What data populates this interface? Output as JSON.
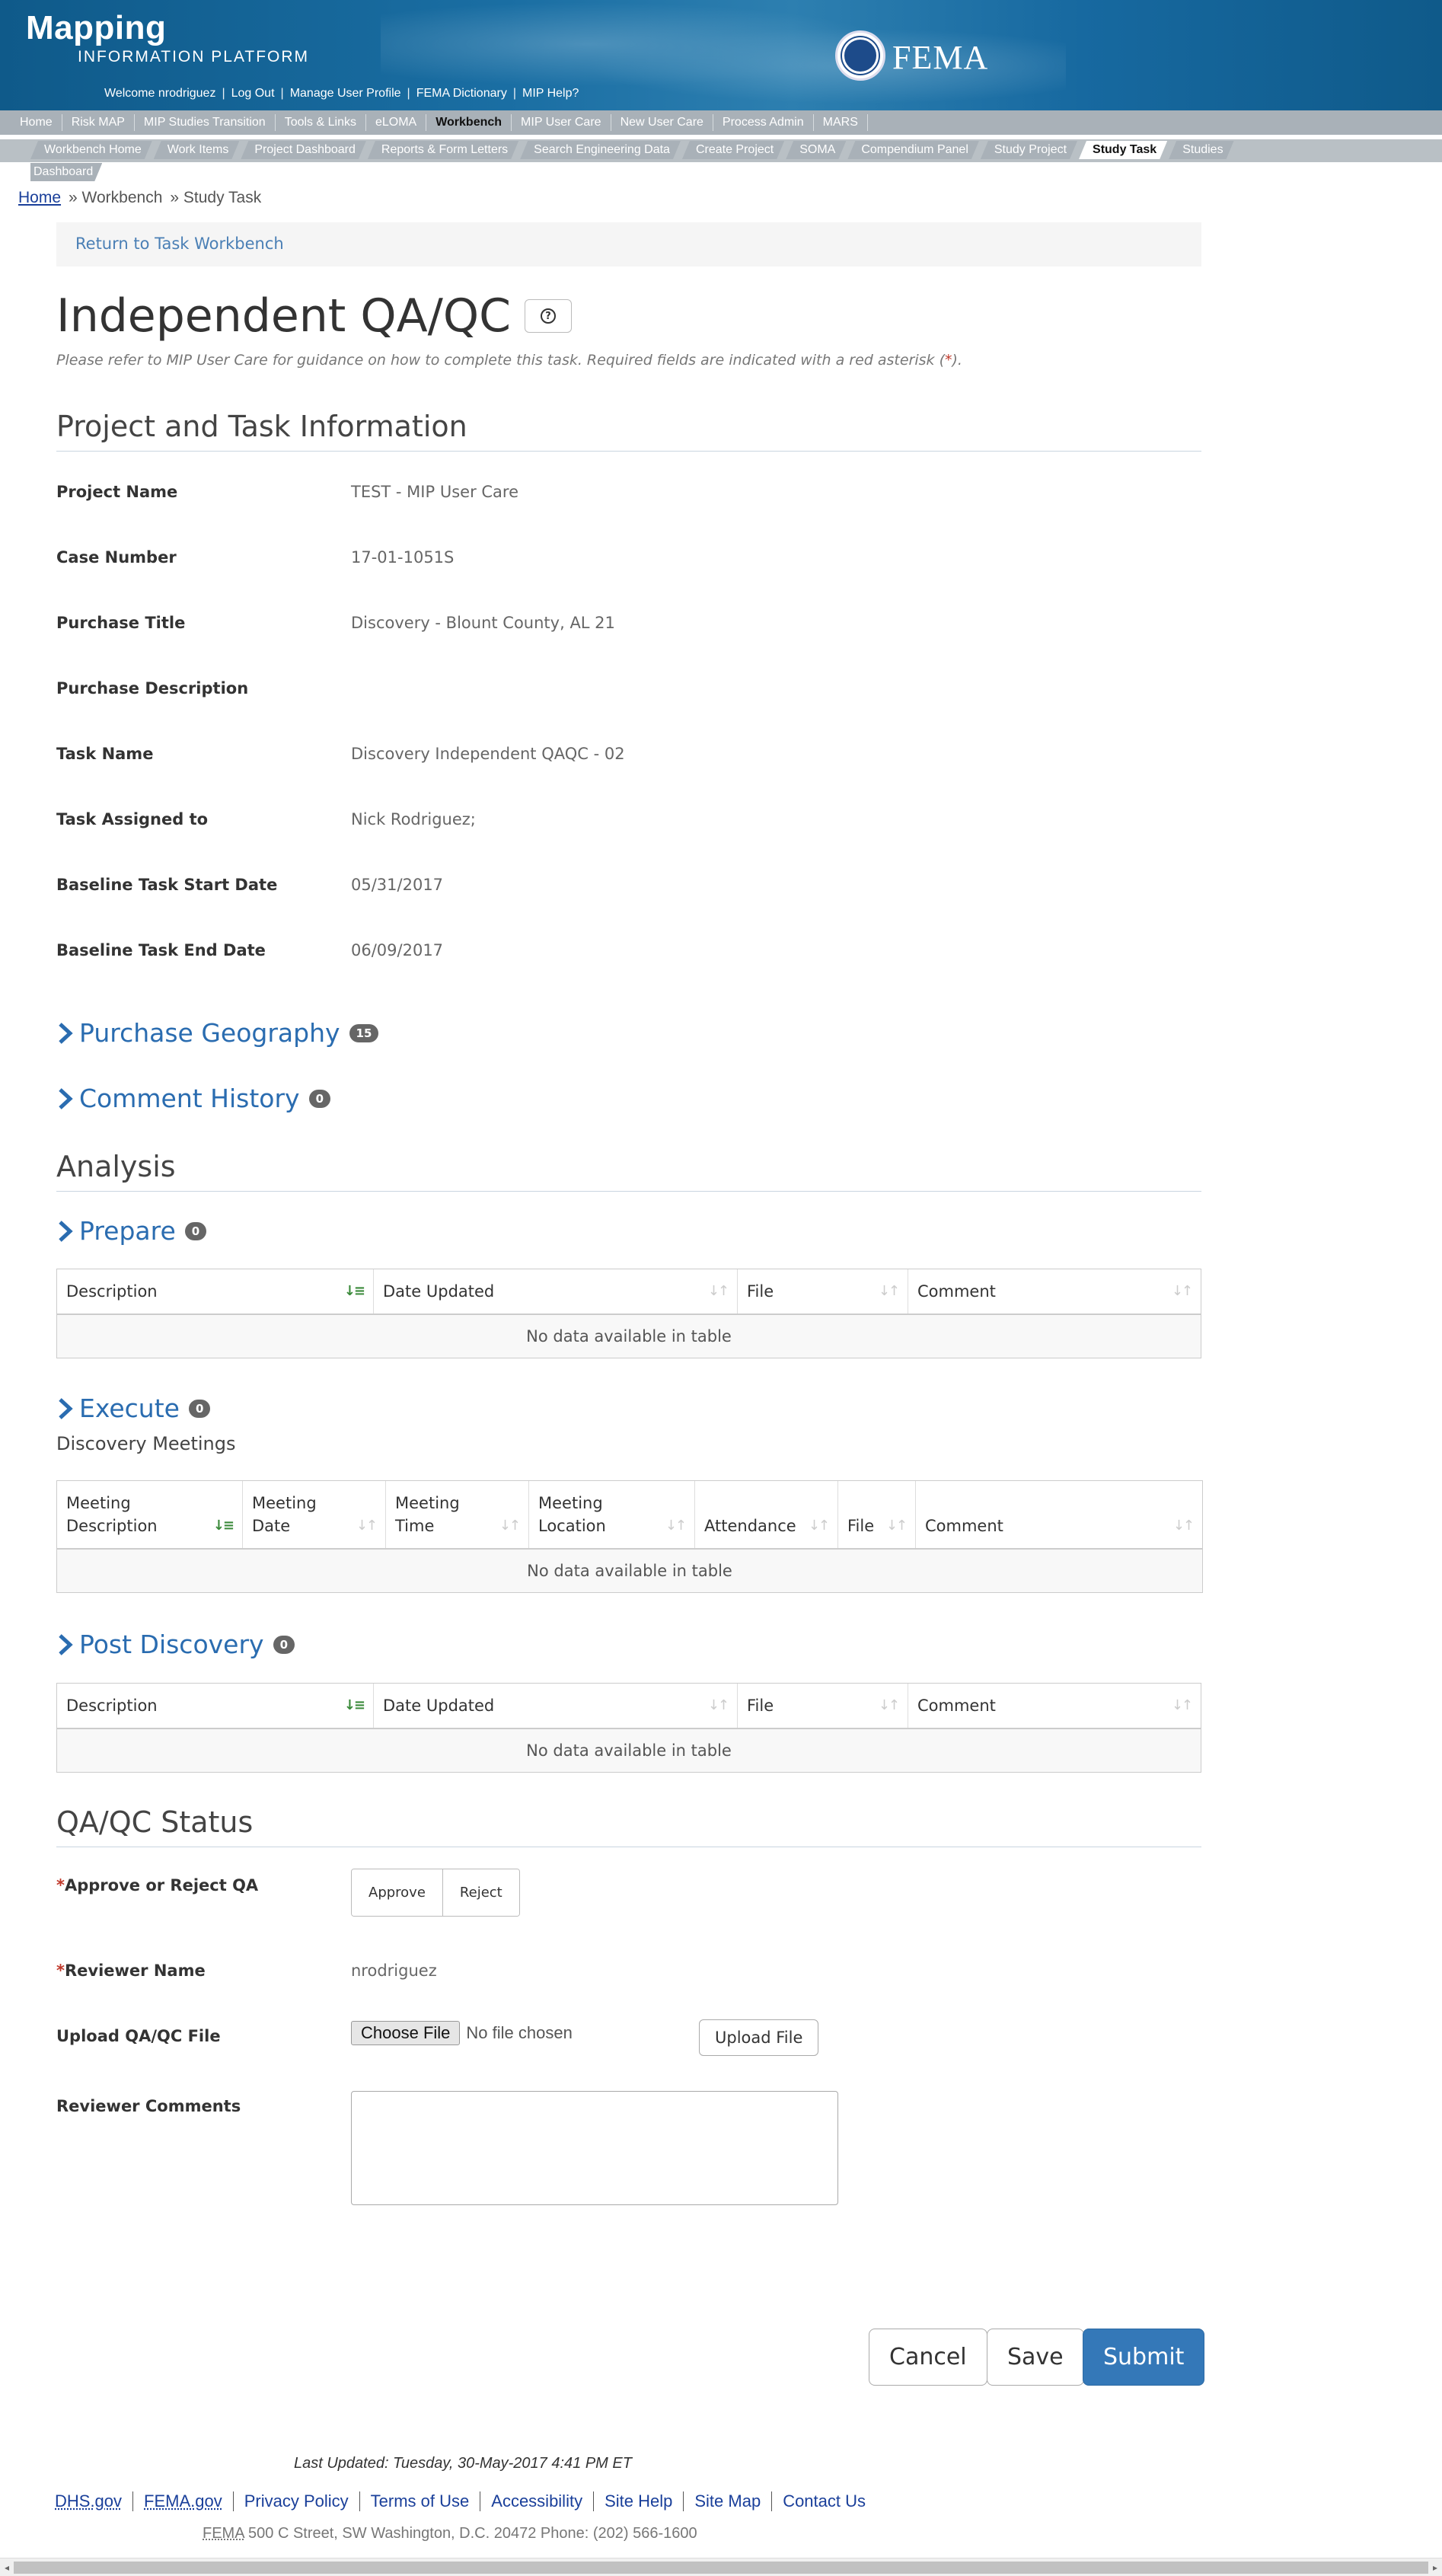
{
  "header": {
    "logo_main": "Mapping",
    "logo_sub": "INFORMATION PLATFORM",
    "agency": "FEMA",
    "welcome_links": [
      "Welcome nrodriguez",
      "Log Out",
      "Manage User Profile",
      "FEMA Dictionary",
      "MIP Help?"
    ]
  },
  "topnav": [
    "Home",
    "Risk MAP",
    "MIP Studies Transition",
    "Tools & Links",
    "eLOMA",
    "Workbench",
    "MIP User Care",
    "New User Care",
    "Process Admin",
    "MARS"
  ],
  "topnav_active": "Workbench",
  "subnav": [
    "Workbench Home",
    "Work Items",
    "Project Dashboard",
    "Reports & Form Letters",
    "Search Engineering Data",
    "Create Project",
    "SOMA",
    "Compendium Panel",
    "Study Project",
    "Study Task",
    "Studies"
  ],
  "subnav_active": "Study Task",
  "subnav_overflow": "Dashboard",
  "breadcrumb": {
    "home": "Home",
    "workbench": "» Workbench",
    "current": "» Study Task"
  },
  "return_link": "Return to Task Workbench",
  "page_title": "Independent QA/QC",
  "guidance": {
    "text": "Please refer to MIP User Care for guidance on how to complete this task. Required fields are indicated with a red asterisk (",
    "ast": "*",
    "end": ")."
  },
  "project_section": {
    "title": "Project and Task Information",
    "fields": [
      {
        "label": "Project Name",
        "value": "TEST - MIP User Care"
      },
      {
        "label": "Case Number",
        "value": "17-01-1051S"
      },
      {
        "label": "Purchase Title",
        "value": "Discovery - Blount County, AL 21"
      },
      {
        "label": "Purchase Description",
        "value": ""
      },
      {
        "label": "Task Name",
        "value": "Discovery Independent QAQC - 02"
      },
      {
        "label": "Task Assigned to",
        "value": "Nick Rodriguez;"
      },
      {
        "label": "Baseline Task Start Date",
        "value": "05/31/2017"
      },
      {
        "label": "Baseline Task End Date",
        "value": "06/09/2017"
      }
    ]
  },
  "purchase_geography": {
    "label": "Purchase Geography",
    "count": "15"
  },
  "comment_history": {
    "label": "Comment History",
    "count": "0"
  },
  "analysis": {
    "title": "Analysis",
    "prepare": {
      "label": "Prepare",
      "count": "0",
      "columns": [
        "Description",
        "Date Updated",
        "File",
        "Comment"
      ],
      "empty": "No data available in table"
    },
    "execute": {
      "label": "Execute",
      "count": "0",
      "subheading": "Discovery Meetings",
      "columns": [
        "Meeting Description",
        "Meeting Date",
        "Meeting Time",
        "Meeting Location",
        "Attendance",
        "File",
        "Comment"
      ],
      "empty": "No data available in table"
    },
    "post_discovery": {
      "label": "Post Discovery",
      "count": "0",
      "columns": [
        "Description",
        "Date Updated",
        "File",
        "Comment"
      ],
      "empty": "No data available in table"
    }
  },
  "qaqc": {
    "title": "QA/QC Status",
    "approve_label": "Approve or Reject QA",
    "approve_btn": "Approve",
    "reject_btn": "Reject",
    "reviewer_label": "Reviewer Name",
    "reviewer_value": "nrodriguez",
    "upload_label": "Upload QA/QC File",
    "choose_file": "Choose File",
    "no_file": "No file chosen",
    "upload_btn": "Upload File",
    "comments_label": "Reviewer Comments",
    "comments_value": ""
  },
  "actions": {
    "cancel": "Cancel",
    "save": "Save",
    "submit": "Submit"
  },
  "footer": {
    "updated": "Last Updated: Tuesday, 30-May-2017 4:41 PM ET",
    "links": [
      "DHS.gov",
      "FEMA.gov",
      "Privacy Policy",
      "Terms of Use",
      "Accessibility",
      "Site Help",
      "Site Map",
      "Contact Us"
    ],
    "addr_abbr": "FEMA",
    "addr": "500 C Street, SW Washington, D.C. 20472 Phone: (202) 566-1600"
  }
}
